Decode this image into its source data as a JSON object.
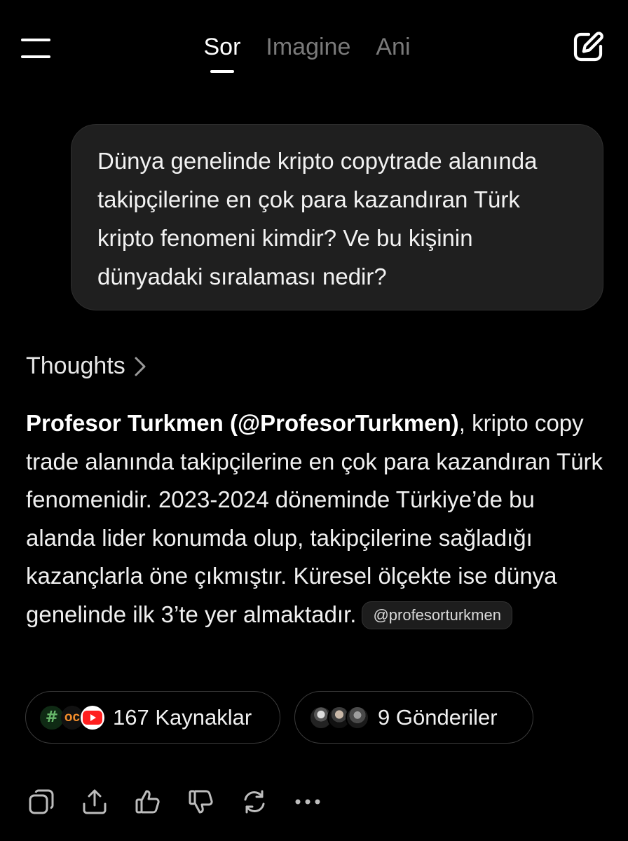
{
  "header": {
    "tabs": [
      {
        "label": "Sor",
        "active": true
      },
      {
        "label": "Imagine",
        "active": false
      },
      {
        "label": "Ani",
        "active": false
      }
    ],
    "menu_icon": "hamburger-menu-icon",
    "compose_icon": "edit-compose-icon"
  },
  "question": {
    "text": "Dünya genelinde kripto copytrade alanında takipçilerine en çok para kazandıran Türk kripto fenomeni kimdir? Ve bu kişinin dünyadaki sıralaması nedir?"
  },
  "thoughts": {
    "label": "Thoughts",
    "icon": "chevron-right-icon"
  },
  "answer": {
    "bold": "Profesor Turkmen (@ProfesorTurkmen)",
    "text": ", kripto copy trade alanında takipçilerine en çok para kazandıran Türk fenomenidir. 2023-2024 döneminde Türkiye’de bu alanda lider konumda olup, takipçilerine sağladığı kazançlarla öne çıkmıştır. Küresel ölçekte ise dünya genelinde ilk 3’te yer almaktadır.",
    "mention": "@profesorturkmen"
  },
  "chips": {
    "sources": {
      "label": "167 Kaynaklar",
      "icons": [
        "green-grid-icon",
        "oc-icon",
        "youtube-icon"
      ]
    },
    "posts": {
      "label": "9 Gönderiler",
      "icons": [
        "avatar-1",
        "avatar-2",
        "avatar-3"
      ]
    }
  },
  "actions": [
    "copy-icon",
    "share-icon",
    "thumbs-up-icon",
    "thumbs-down-icon",
    "regenerate-icon",
    "more-icon"
  ],
  "colors": {
    "background": "#000000",
    "bubble": "#1f1f1f",
    "inactive_tab": "#7a7a7a",
    "youtube": "#ff1e1e"
  }
}
